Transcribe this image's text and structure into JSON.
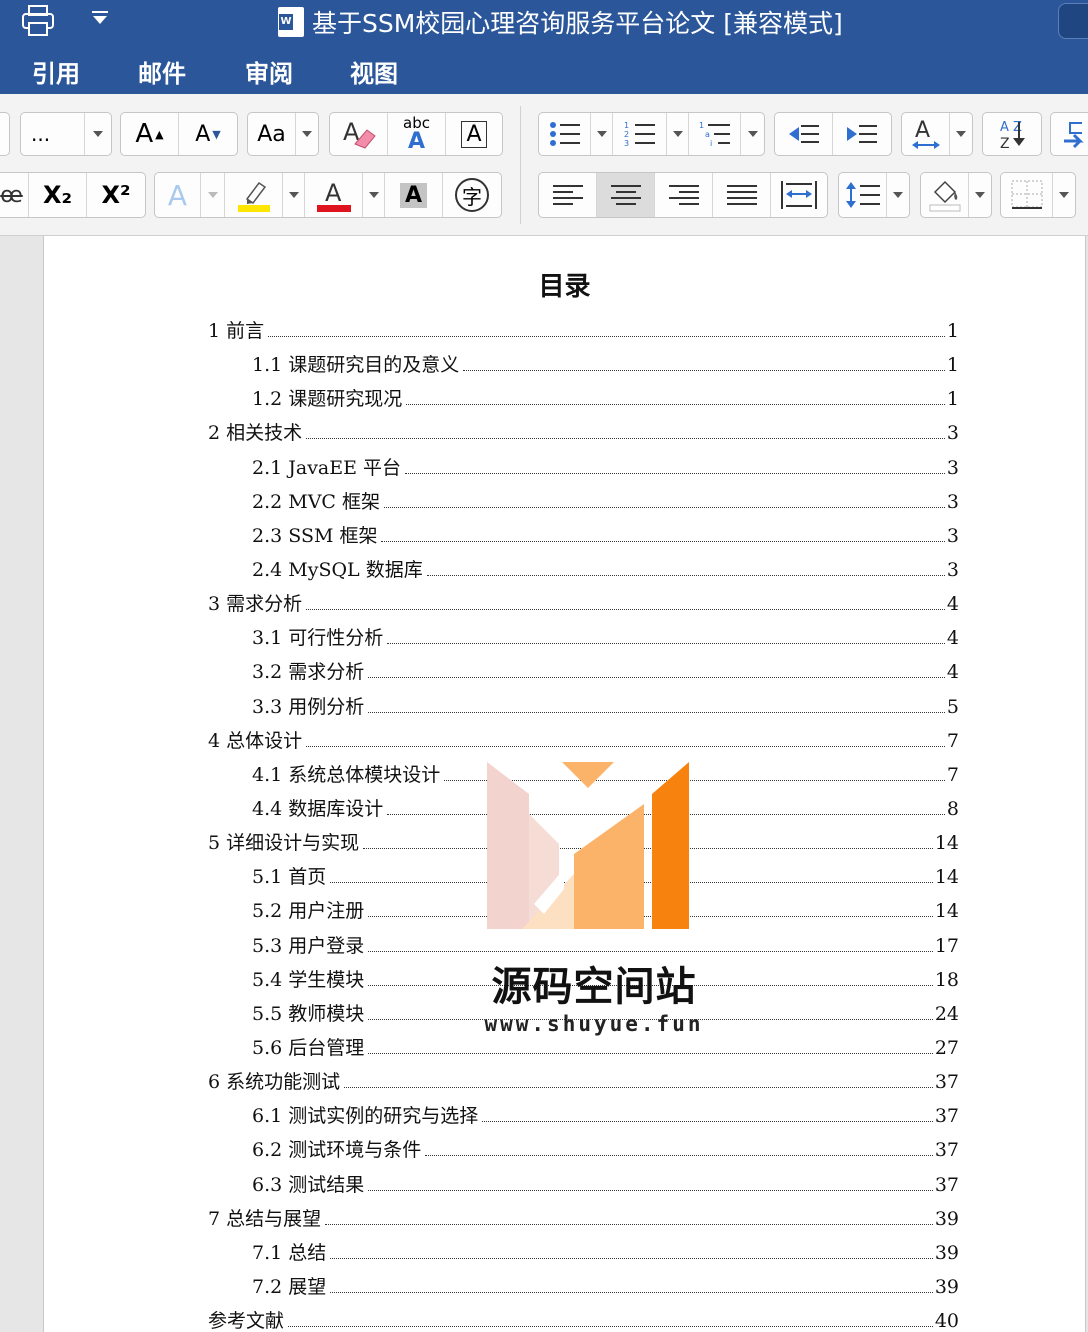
{
  "window": {
    "title": "基于SSM校园心理咨询服务平台论文 [兼容模式]",
    "print_icon": "printer-icon",
    "customize_icon": "chevron-down-icon",
    "doc_icon": "word-doc-icon"
  },
  "ribbon": {
    "tabs": [
      "引用",
      "邮件",
      "审阅",
      "视图"
    ]
  },
  "toolbar": {
    "font_size_value": "...",
    "grow_font_label": "A",
    "shrink_font_label": "A",
    "change_case_label": "Aa",
    "clear_format_label": "A",
    "text_effects_label": "abc",
    "char_border_label": "A",
    "subscript_label": "X₂",
    "superscript_label": "X²",
    "font_color_label": "A",
    "char_shading_label": "A",
    "enclose_char_label": "字",
    "strikethrough_label": "abc",
    "sort_label": "A Z",
    "colors": {
      "accent": "#2b579a",
      "highlight": "#ffe600",
      "font_color": "#e0141e"
    }
  },
  "document": {
    "toc_title": "目录",
    "entries": [
      {
        "label": "1  前言",
        "page": "1",
        "level": 1
      },
      {
        "label": "1.1  课题研究目的及意义",
        "page": "1",
        "level": 2
      },
      {
        "label": "1.2 课题研究现况",
        "page": "1",
        "level": 2
      },
      {
        "label": "2  相关技术",
        "page": "3",
        "level": 1
      },
      {
        "label": "2.1 JavaEE 平台",
        "page": "3",
        "level": 2
      },
      {
        "label": "2.2 MVC  框架",
        "page": "3",
        "level": 2
      },
      {
        "label": "2.3 SSM  框架",
        "page": "3",
        "level": 2
      },
      {
        "label": "2.4 MySQL 数据库",
        "page": "3",
        "level": 2
      },
      {
        "label": "3  需求分析",
        "page": "4",
        "level": 1
      },
      {
        "label": "3.1  可行性分析",
        "page": "4",
        "level": 2
      },
      {
        "label": "3.2 需求分析",
        "page": "4",
        "level": 2
      },
      {
        "label": "3.3 用例分析",
        "page": "5",
        "level": 2
      },
      {
        "label": "4  总体设计",
        "page": "7",
        "level": 1
      },
      {
        "label": "4.1 系统总体模块设计",
        "page": "7",
        "level": 2
      },
      {
        "label": "4.4 数据库设计",
        "page": "8",
        "level": 2
      },
      {
        "label": "5  详细设计与实现",
        "page": "14",
        "level": 1
      },
      {
        "label": "5.1 首页",
        "page": "14",
        "level": 2
      },
      {
        "label": "5.2  用户注册",
        "page": "14",
        "level": 2
      },
      {
        "label": "5.3  用户登录",
        "page": "17",
        "level": 2
      },
      {
        "label": "5.4  学生模块",
        "page": "18",
        "level": 2
      },
      {
        "label": "5.5  教师模块",
        "page": "24",
        "level": 2
      },
      {
        "label": "5.6 后台管理",
        "page": "27",
        "level": 2
      },
      {
        "label": "6  系统功能测试",
        "page": "37",
        "level": 1
      },
      {
        "label": "6.1  测试实例的研究与选择",
        "page": "37",
        "level": 2
      },
      {
        "label": "6.2  测试环境与条件",
        "page": "37",
        "level": 2
      },
      {
        "label": "6.3  测试结果",
        "page": "37",
        "level": 2
      },
      {
        "label": "7  总结与展望",
        "page": "39",
        "level": 1
      },
      {
        "label": "7.1  总结",
        "page": "39",
        "level": 2
      },
      {
        "label": "7.2  展望",
        "page": "39",
        "level": 2
      },
      {
        "label": "参考文献",
        "page": "40",
        "level": 1
      }
    ]
  },
  "watermark": {
    "name": "源码空间站",
    "url": "www.shuyue.fun",
    "colors": {
      "orange": "#f7820d",
      "light_orange": "#fbb36a",
      "pink": "#f3d3cd"
    }
  }
}
